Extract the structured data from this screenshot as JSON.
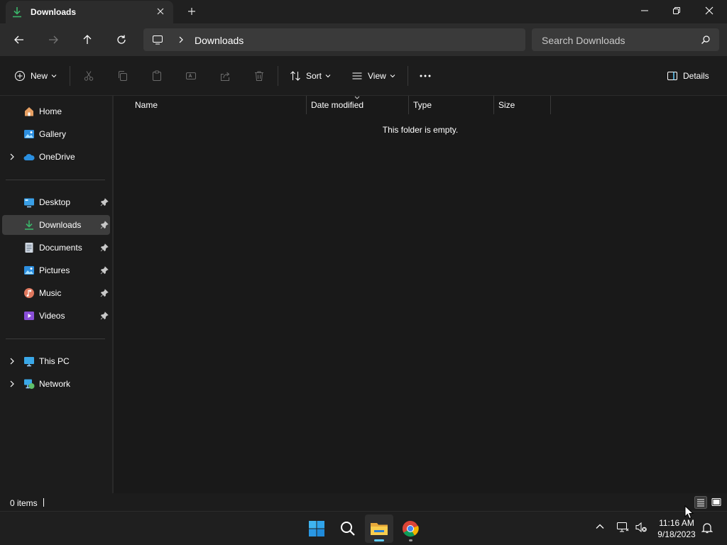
{
  "window": {
    "tab_title": "Downloads",
    "icons": {
      "tab": "download-icon",
      "close_tab": "close-icon",
      "new_tab": "plus-icon"
    }
  },
  "navigation": {
    "back": "back-arrow-icon",
    "forward": "forward-arrow-icon",
    "up": "up-arrow-icon",
    "refresh": "refresh-icon"
  },
  "address": {
    "root_icon": "this-pc-icon",
    "crumbs": [
      "Downloads"
    ]
  },
  "search": {
    "placeholder": "Search Downloads"
  },
  "commands": {
    "new_label": "New",
    "sort_label": "Sort",
    "view_label": "View",
    "details_label": "Details",
    "disabled_icons": [
      "cut-icon",
      "copy-icon",
      "paste-icon",
      "rename-icon",
      "share-icon",
      "delete-icon"
    ]
  },
  "sidebar": {
    "top": [
      {
        "label": "Home",
        "icon": "home-icon"
      },
      {
        "label": "Gallery",
        "icon": "gallery-icon"
      },
      {
        "label": "OneDrive",
        "icon": "onedrive-icon",
        "expandable": true
      }
    ],
    "pinned": [
      {
        "label": "Desktop",
        "icon": "desktop-icon"
      },
      {
        "label": "Downloads",
        "icon": "download-icon",
        "selected": true
      },
      {
        "label": "Documents",
        "icon": "documents-icon"
      },
      {
        "label": "Pictures",
        "icon": "pictures-icon"
      },
      {
        "label": "Music",
        "icon": "music-icon"
      },
      {
        "label": "Videos",
        "icon": "videos-icon"
      }
    ],
    "bottom": [
      {
        "label": "This PC",
        "icon": "this-pc-icon",
        "expandable": true
      },
      {
        "label": "Network",
        "icon": "network-icon",
        "expandable": true
      }
    ]
  },
  "list": {
    "columns": [
      "Name",
      "Date modified",
      "Type",
      "Size"
    ],
    "sorted_column": "Date modified",
    "empty_message": "This folder is empty."
  },
  "status": {
    "item_count": "0 items"
  },
  "taskbar": {
    "apps": [
      "start-icon",
      "search-icon",
      "file-explorer-icon",
      "chrome-icon"
    ],
    "active_app": "file-explorer-icon",
    "tray": [
      "chevron-up-icon",
      "network-icon",
      "volume-muted-icon",
      "notification-bell-icon"
    ],
    "time": "11:16 AM",
    "date": "9/18/2023"
  },
  "colors": {
    "accent": "#60cdff",
    "download_green": "#3bb56a",
    "window_bg": "#191919"
  }
}
